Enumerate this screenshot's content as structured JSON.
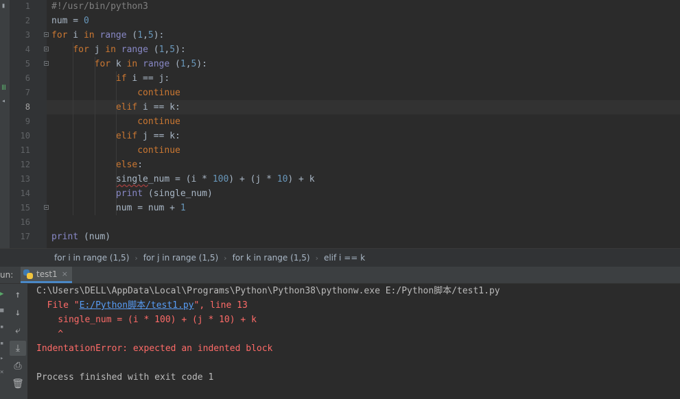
{
  "editor": {
    "lines": [
      {
        "n": "1",
        "tokens": [
          {
            "t": "#!/usr/bin/python3",
            "c": "cm"
          }
        ]
      },
      {
        "n": "2",
        "tokens": [
          {
            "t": "num = "
          },
          {
            "t": "0",
            "c": "num"
          }
        ]
      },
      {
        "n": "3",
        "fold": true,
        "tokens": [
          {
            "t": "for",
            "c": "kw"
          },
          {
            "t": " i "
          },
          {
            "t": "in",
            "c": "kw"
          },
          {
            "t": " "
          },
          {
            "t": "range",
            "c": "bi"
          },
          {
            "t": " ("
          },
          {
            "t": "1",
            "c": "num"
          },
          {
            "t": ","
          },
          {
            "t": "5",
            "c": "num"
          },
          {
            "t": "):"
          }
        ]
      },
      {
        "n": "4",
        "fold": true,
        "tokens": [
          {
            "t": "    "
          },
          {
            "t": "for",
            "c": "kw"
          },
          {
            "t": " j "
          },
          {
            "t": "in",
            "c": "kw"
          },
          {
            "t": " "
          },
          {
            "t": "range",
            "c": "bi"
          },
          {
            "t": " ("
          },
          {
            "t": "1",
            "c": "num"
          },
          {
            "t": ","
          },
          {
            "t": "5",
            "c": "num"
          },
          {
            "t": "):"
          }
        ]
      },
      {
        "n": "5",
        "fold": true,
        "tokens": [
          {
            "t": "        "
          },
          {
            "t": "for",
            "c": "kw"
          },
          {
            "t": " k "
          },
          {
            "t": "in",
            "c": "kw"
          },
          {
            "t": " "
          },
          {
            "t": "range",
            "c": "bi"
          },
          {
            "t": " ("
          },
          {
            "t": "1",
            "c": "num"
          },
          {
            "t": ","
          },
          {
            "t": "5",
            "c": "num"
          },
          {
            "t": "):"
          }
        ]
      },
      {
        "n": "6",
        "tokens": [
          {
            "t": "            "
          },
          {
            "t": "if",
            "c": "kw"
          },
          {
            "t": " i == j:"
          }
        ]
      },
      {
        "n": "7",
        "tokens": [
          {
            "t": "                "
          },
          {
            "t": "continue",
            "c": "kw"
          }
        ]
      },
      {
        "n": "8",
        "current": true,
        "tokens": [
          {
            "t": "            "
          },
          {
            "t": "elif",
            "c": "kw"
          },
          {
            "t": " i == k:"
          }
        ]
      },
      {
        "n": "9",
        "tokens": [
          {
            "t": "                "
          },
          {
            "t": "continue",
            "c": "kw"
          }
        ]
      },
      {
        "n": "10",
        "tokens": [
          {
            "t": "            "
          },
          {
            "t": "elif",
            "c": "kw"
          },
          {
            "t": " j == k:"
          }
        ]
      },
      {
        "n": "11",
        "tokens": [
          {
            "t": "                "
          },
          {
            "t": "continue",
            "c": "kw"
          }
        ]
      },
      {
        "n": "12",
        "tokens": [
          {
            "t": "            "
          },
          {
            "t": "else",
            "c": "kw"
          },
          {
            "t": ":"
          }
        ]
      },
      {
        "n": "13",
        "tokens": [
          {
            "t": "            "
          },
          {
            "t": "single",
            "c": "typo"
          },
          {
            "t": "_num = (i * "
          },
          {
            "t": "100",
            "c": "num"
          },
          {
            "t": ") + (j * "
          },
          {
            "t": "10",
            "c": "num"
          },
          {
            "t": ") + k"
          }
        ]
      },
      {
        "n": "14",
        "tokens": [
          {
            "t": "            "
          },
          {
            "t": "print",
            "c": "bi"
          },
          {
            "t": " (single_num)"
          }
        ]
      },
      {
        "n": "15",
        "fold": true,
        "tokens": [
          {
            "t": "            num = num + "
          },
          {
            "t": "1",
            "c": "num"
          }
        ]
      },
      {
        "n": "16",
        "tokens": []
      },
      {
        "n": "17",
        "tokens": [
          {
            "t": "print",
            "c": "bi"
          },
          {
            "t": " (num)"
          }
        ]
      }
    ]
  },
  "breadcrumb": [
    "for i in range (1,5)",
    "for j in range (1,5)",
    "for k in range (1,5)",
    "elif i == k"
  ],
  "run": {
    "label": "un:",
    "tab": {
      "label": "test1",
      "close": "×"
    },
    "console": {
      "command": "C:\\Users\\DELL\\AppData\\Local\\Programs\\Python\\Python38\\pythonw.exe E:/Python脚本/test1.py",
      "file_prefix": "  File \"",
      "file_link": "E:/Python脚本/test1.py",
      "file_suffix": "\", line 13",
      "code_line": "    single_num = (i * 100) + (j * 10) + k",
      "caret": "    ^",
      "error": "IndentationError: expected an indented block",
      "finished": "Process finished with exit code 1"
    }
  },
  "colors": {
    "background": "#2b2b2b",
    "keyword": "#cc7832",
    "builtin": "#8888c6",
    "number": "#6897bb",
    "comment": "#808080",
    "error": "#ff6b68",
    "link": "#589df6"
  }
}
